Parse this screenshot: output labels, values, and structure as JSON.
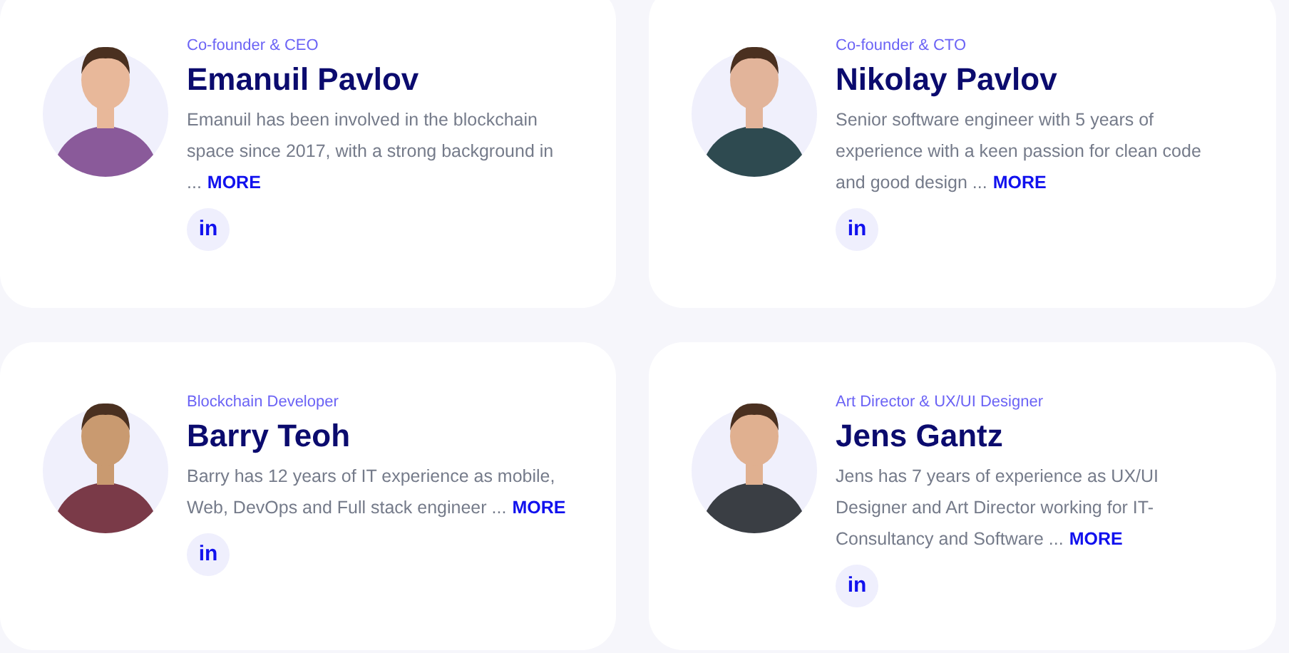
{
  "team": [
    {
      "role": "Co-founder & CEO",
      "name": "Emanuil Pavlov",
      "bio": "Emanuil has been involved in the blockchain space since 2017, with a strong background in ...",
      "more": "MORE",
      "social": "in"
    },
    {
      "role": "Co-founder & CTO",
      "name": "Nikolay Pavlov",
      "bio": "Senior software engineer with 5 years of experience with a keen passion for clean code and good design ...",
      "more": "MORE",
      "social": "in"
    },
    {
      "role": "Blockchain Developer",
      "name": "Barry Teoh",
      "bio": "Barry has 12 years of IT experience as mobile, Web, DevOps and Full stack engineer ...",
      "more": "MORE",
      "social": "in"
    },
    {
      "role": "Art Director & UX/UI Designer",
      "name": "Jens Gantz",
      "bio": "Jens has 7 years of experience as UX/UI Designer and Art Director working for IT-Consultancy and Software ...",
      "more": "MORE",
      "social": "in"
    }
  ]
}
